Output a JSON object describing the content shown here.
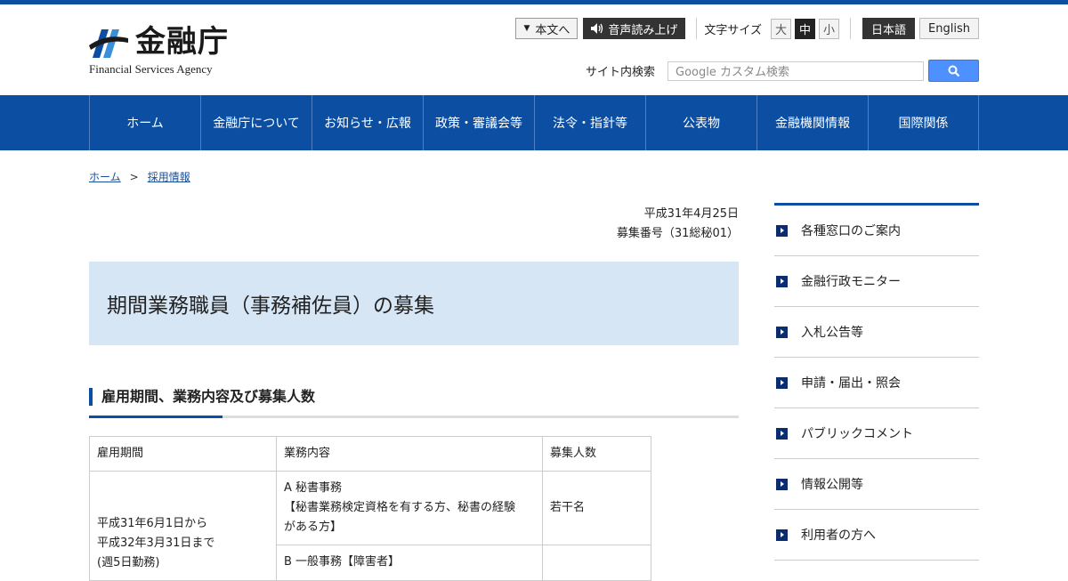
{
  "header": {
    "logo_ja": "金融庁",
    "logo_en": "Financial Services Agency",
    "skip_label": "本文へ",
    "voice_label": "音声読み上げ",
    "font_size_label": "文字サイズ",
    "font_sizes": [
      "大",
      "中",
      "小"
    ],
    "font_size_selected": "中",
    "lang_ja": "日本語",
    "lang_en": "English",
    "search_label": "サイト内検索",
    "search_placeholder": "Google カスタム検索"
  },
  "nav": [
    "ホーム",
    "金融庁について",
    "お知らせ・広報",
    "政策・審議会等",
    "法令・指針等",
    "公表物",
    "金融機関情報",
    "国際関係"
  ],
  "breadcrumb": {
    "home": "ホーム",
    "separator": ">",
    "current": "採用情報"
  },
  "main": {
    "date": "平成31年4月25日",
    "recruit_no": "募集番号（31総秘01）",
    "title": "期間業務職員（事務補佐員）の募集",
    "section_title": "雇用期間、業務内容及び募集人数",
    "table": {
      "headers": [
        "雇用期間",
        "業務内容",
        "募集人数"
      ],
      "period_line1": "平成31年6月1日から",
      "period_line2": "平成32年3月31日まで",
      "period_line3": "(週5日勤務)",
      "row1_task_line1": "A 秘書事務",
      "row1_task_line2": "【秘書業務検定資格を有する方、秘書の経験",
      "row1_task_line3": "がある方】",
      "row1_count": "若干名",
      "row2_task": "B 一般事務【障害者】"
    }
  },
  "sidebar": [
    "各種窓口のご案内",
    "金融行政モニター",
    "入札公告等",
    "申請・届出・照会",
    "パブリックコメント",
    "情報公開等",
    "利用者の方へ"
  ],
  "colors": {
    "brand_blue": "#0b4ea2",
    "title_bg": "#d6e6f5",
    "search_button": "#4d90fe"
  }
}
